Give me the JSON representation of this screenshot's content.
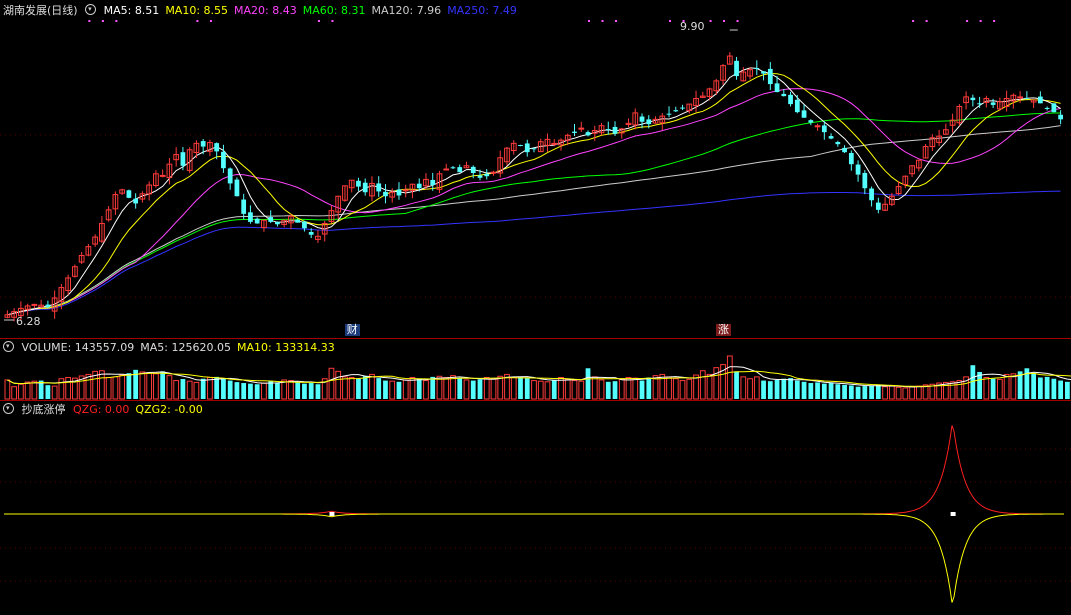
{
  "colors": {
    "bg": "#000000",
    "up": "#ff3b3b",
    "down": "#54ffff",
    "grid": "#7a0000",
    "ma5": "#ffffff",
    "ma10": "#ffff00",
    "ma20": "#ff44ff",
    "ma60": "#00ff00",
    "ma120": "#cccccc",
    "ma250": "#3333ff",
    "qzg": "#ff2020",
    "qzg2": "#ffff00"
  },
  "price_pane": {
    "toggle_icon": "circle-toggle-icon",
    "title": "湖南发展(日线)",
    "indicators": [
      {
        "label": "MA5:",
        "value": "8.51",
        "color": "#ffffff"
      },
      {
        "label": "MA10:",
        "value": "8.55",
        "color": "#ffff00"
      },
      {
        "label": "MA20:",
        "value": "8.43",
        "color": "#ff44ff"
      },
      {
        "label": "MA60:",
        "value": "8.31",
        "color": "#00ff00"
      },
      {
        "label": "MA120:",
        "value": "7.96",
        "color": "#cccccc"
      },
      {
        "label": "MA250:",
        "value": "7.49",
        "color": "#3333ff"
      }
    ],
    "high_label": "9.90",
    "low_label": "6.28",
    "events": [
      {
        "text": "财",
        "index": 51
      },
      {
        "text": "涨",
        "index": 106
      }
    ]
  },
  "volume_pane": {
    "toggle_icon": "circle-toggle-icon",
    "indicators": [
      {
        "label": "VOLUME:",
        "value": "143557.09",
        "color": "#dddddd"
      },
      {
        "label": "MA5:",
        "value": "125620.05",
        "color": "#dddddd"
      },
      {
        "label": "MA10:",
        "value": "133314.33",
        "color": "#ffff00"
      }
    ]
  },
  "indicator_pane": {
    "toggle_icon": "circle-toggle-icon",
    "title": "抄底涨停",
    "indicators": [
      {
        "label": "QZG:",
        "value": "0.00",
        "color": "#ff2020"
      },
      {
        "label": "QZG2:",
        "value": "-0.00",
        "color": "#ffff00"
      }
    ]
  },
  "chart_data": {
    "type": "candlestick",
    "price_range": [
      6.28,
      9.9
    ],
    "closes": [
      6.32,
      6.36,
      6.4,
      6.43,
      6.45,
      6.44,
      6.42,
      6.53,
      6.66,
      6.78,
      6.92,
      7.06,
      7.17,
      7.29,
      7.46,
      7.63,
      7.82,
      7.88,
      7.78,
      7.71,
      7.83,
      7.94,
      8.08,
      8.06,
      8.2,
      8.32,
      8.18,
      8.38,
      8.46,
      8.42,
      8.47,
      8.36,
      8.15,
      7.96,
      7.8,
      7.58,
      7.48,
      7.46,
      7.5,
      7.48,
      7.45,
      7.5,
      7.55,
      7.47,
      7.4,
      7.32,
      7.3,
      7.46,
      7.62,
      7.8,
      7.93,
      8.0,
      7.92,
      7.85,
      7.96,
      7.86,
      7.8,
      7.85,
      7.81,
      7.88,
      7.95,
      7.9,
      8.01,
      7.94,
      8.08,
      8.14,
      8.16,
      8.1,
      8.18,
      8.09,
      8.03,
      8.05,
      8.1,
      8.28,
      8.4,
      8.46,
      8.43,
      8.35,
      8.39,
      8.48,
      8.51,
      8.46,
      8.5,
      8.56,
      8.59,
      8.65,
      8.56,
      8.62,
      8.68,
      8.63,
      8.58,
      8.64,
      8.71,
      8.84,
      8.73,
      8.7,
      8.76,
      8.8,
      8.83,
      8.86,
      8.9,
      8.95,
      9.02,
      9.05,
      9.14,
      9.24,
      9.43,
      9.55,
      9.3,
      9.35,
      9.38,
      9.4,
      9.33,
      9.2,
      9.1,
      9.05,
      8.95,
      8.85,
      8.78,
      8.72,
      8.68,
      8.6,
      8.52,
      8.45,
      8.35,
      8.2,
      8.07,
      7.9,
      7.75,
      7.63,
      7.7,
      7.8,
      7.92,
      8.05,
      8.18,
      8.25,
      8.42,
      8.53,
      8.55,
      8.63,
      8.75,
      8.92,
      9.04,
      9.0,
      8.96,
      9.02,
      8.94,
      8.98,
      9.02,
      9.06,
      9.04,
      9.02,
      9.0,
      8.96,
      8.9,
      8.85,
      8.76
    ],
    "series": [
      {
        "name": "MA5",
        "value": 8.51
      },
      {
        "name": "MA10",
        "value": 8.55
      },
      {
        "name": "MA20",
        "value": 8.43
      },
      {
        "name": "MA60",
        "value": 8.31
      },
      {
        "name": "MA120",
        "value": 7.96
      },
      {
        "name": "MA250",
        "value": 7.49
      }
    ],
    "volume": {
      "bars": [
        62,
        40,
        48,
        55,
        58,
        60,
        45,
        42,
        66,
        70,
        68,
        75,
        80,
        90,
        92,
        70,
        72,
        78,
        84,
        95,
        88,
        86,
        82,
        90,
        76,
        60,
        65,
        58,
        54,
        66,
        70,
        72,
        68,
        60,
        55,
        52,
        50,
        48,
        52,
        58,
        54,
        62,
        60,
        55,
        50,
        52,
        48,
        66,
        100,
        90,
        72,
        70,
        66,
        74,
        80,
        68,
        60,
        58,
        56,
        62,
        70,
        66,
        60,
        72,
        74,
        70,
        76,
        68,
        62,
        60,
        64,
        70,
        66,
        74,
        80,
        70,
        72,
        68,
        60,
        58,
        56,
        62,
        70,
        64,
        60,
        58,
        100,
        72,
        62,
        56,
        58,
        64,
        70,
        68,
        60,
        70,
        76,
        80,
        72,
        66,
        60,
        64,
        78,
        92,
        80,
        102,
        112,
        140,
        90,
        72,
        66,
        72,
        60,
        58,
        62,
        66,
        68,
        60,
        56,
        52,
        54,
        50,
        52,
        48,
        46,
        44,
        40,
        42,
        44,
        46,
        40,
        42,
        38,
        36,
        40,
        42,
        46,
        48,
        52,
        54,
        56,
        60,
        72,
        110,
        88,
        70,
        66,
        64,
        80,
        82,
        90,
        100,
        84,
        70,
        72,
        66,
        60,
        56,
        58
      ],
      "last": 143557.09,
      "ma5": 125620.05,
      "ma10": 133314.33
    },
    "indicator": {
      "name": "抄底涨停",
      "qzg": 0.0,
      "qzg2": -0.0,
      "pulses": [
        {
          "index": 48,
          "amplitude": 0.03
        },
        {
          "index": 140,
          "amplitude": 1.0
        }
      ]
    }
  }
}
